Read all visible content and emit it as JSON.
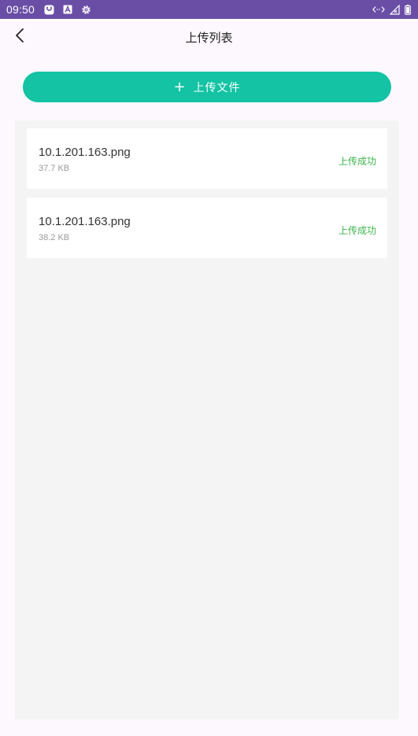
{
  "status_bar": {
    "time": "09:50",
    "icons_left": [
      "notification-icon",
      "a-icon",
      "settings-icon"
    ],
    "icons_right": [
      "data-arrows-icon",
      "signal-icon",
      "battery-icon"
    ]
  },
  "header": {
    "title": "上传列表",
    "back_icon": "chevron-left-icon"
  },
  "upload_button": {
    "icon": "+",
    "label": "上传文件",
    "color": "#13c3a3"
  },
  "files": [
    {
      "name": "10.1.201.163.png",
      "size": "37.7 KB",
      "status": "上传成功"
    },
    {
      "name": "10.1.201.163.png",
      "size": "38.2 KB",
      "status": "上传成功"
    }
  ],
  "colors": {
    "status_bar": "#6a4ea6",
    "accent": "#13c3a3",
    "success": "#3bb44a",
    "list_background": "#f4f4f4"
  }
}
